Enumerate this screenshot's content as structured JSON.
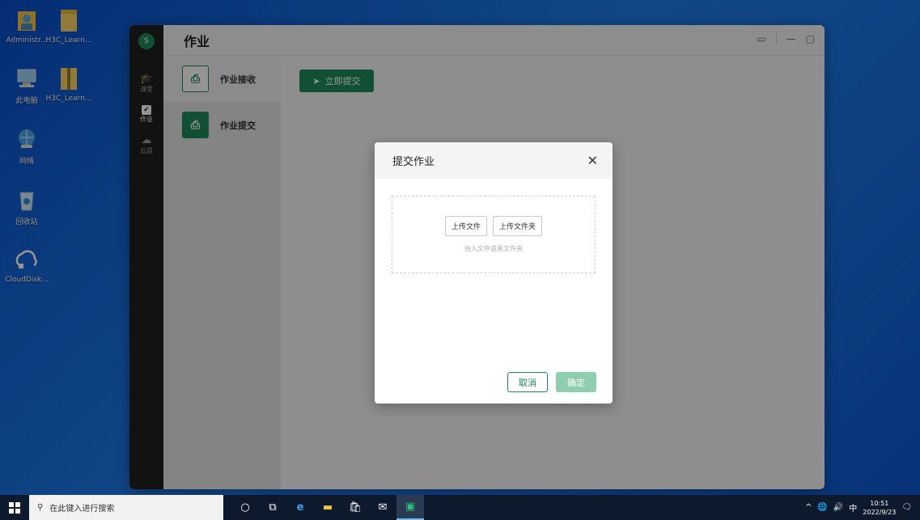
{
  "desktop": {
    "icons": [
      {
        "label": "Administr...",
        "icon": "user-folder-icon"
      },
      {
        "label": "H3C_Learn...",
        "icon": "folder-icon"
      },
      {
        "label": "此电脑",
        "icon": "computer-icon"
      },
      {
        "label": "H3C_Learn...",
        "icon": "zip-folder-icon"
      },
      {
        "label": "网络",
        "icon": "network-icon"
      },
      {
        "label": "回收站",
        "icon": "recycle-bin-icon"
      },
      {
        "label": "CloudDisk...",
        "icon": "cloud-icon"
      }
    ]
  },
  "app": {
    "avatar": "S",
    "title": "作业",
    "rail": [
      {
        "label": "课堂",
        "icon": "graduation-cap-icon"
      },
      {
        "label": "作业",
        "icon": "homework-icon"
      },
      {
        "label": "云盘",
        "icon": "cloud-upload-icon"
      }
    ],
    "subnav": [
      {
        "label": "作业接收",
        "icon": "inbox-icon"
      },
      {
        "label": "作业提交",
        "icon": "outbox-icon"
      }
    ],
    "submit_button": "立即提交"
  },
  "dialog": {
    "title": "提交作业",
    "upload_file": "上传文件",
    "upload_folder": "上传文件夹",
    "hint": "拖入文件或者文件夹",
    "cancel": "取消",
    "confirm": "确定"
  },
  "taskbar": {
    "search_placeholder": "在此键入进行搜索",
    "ime": "中",
    "time": "10:51",
    "date": "2022/9/23"
  },
  "colors": {
    "accent": "#1e8a5a",
    "accent_disabled": "#8fcfb0"
  }
}
